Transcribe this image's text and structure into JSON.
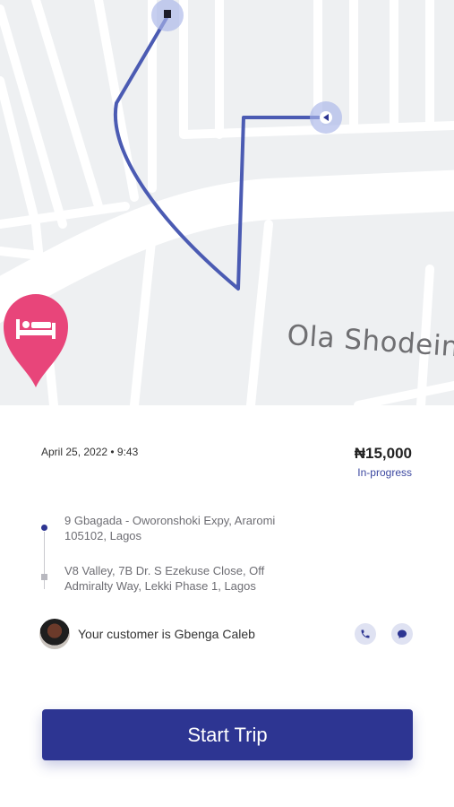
{
  "map": {
    "street_label": "Ola Shodein",
    "route_color": "#4b5bb3",
    "hotel_marker_color": "#e8457a",
    "icons": [
      "origin-marker-icon",
      "driver-location-icon",
      "hotel-marker-icon"
    ]
  },
  "trip": {
    "datetime": "April 25, 2022 • 9:43",
    "price": "₦15,000",
    "status": "In-progress",
    "pickup": "9 Gbagada - Oworonshoki Expy, Araromi 105102, Lagos",
    "dropoff": "V8 Valley, 7B Dr. S Ezekuse Close, Off Admiralty Way, Lekki Phase 1, Lagos"
  },
  "customer": {
    "text": "Your customer is Gbenga Caleb",
    "icons": [
      "phone-icon",
      "chat-icon"
    ]
  },
  "actions": {
    "start_trip_label": "Start Trip"
  },
  "colors": {
    "primary": "#2d3592",
    "status": "#3b47a0"
  }
}
